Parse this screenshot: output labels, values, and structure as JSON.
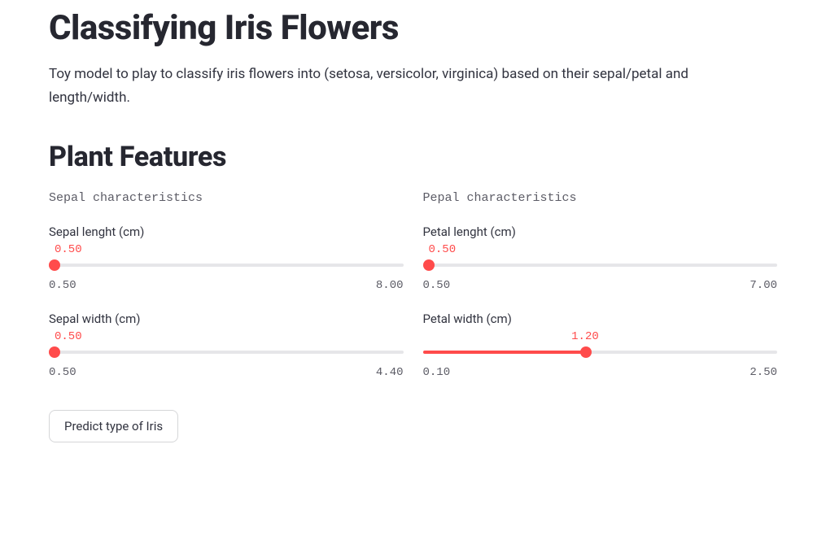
{
  "header": {
    "title": "Classifying Iris Flowers",
    "description": "Toy model to play to classify iris flowers into (setosa, versicolor, virginica) based on their sepal/petal and length/width."
  },
  "section": {
    "title": "Plant Features"
  },
  "left": {
    "group_label": "Sepal characteristics",
    "fields": [
      {
        "label": "Sepal lenght (cm)",
        "value": "0.50",
        "min": "0.50",
        "max": "8.00",
        "percent": 0
      },
      {
        "label": "Sepal width (cm)",
        "value": "0.50",
        "min": "0.50",
        "max": "4.40",
        "percent": 0
      }
    ]
  },
  "right": {
    "group_label": "Pepal characteristics",
    "fields": [
      {
        "label": "Petal lenght (cm)",
        "value": "0.50",
        "min": "0.50",
        "max": "7.00",
        "percent": 0
      },
      {
        "label": "Petal width (cm)",
        "value": "1.20",
        "min": "0.10",
        "max": "2.50",
        "percent": 45.8
      }
    ]
  },
  "button": {
    "label": "Predict type of Iris"
  },
  "colors": {
    "accent": "#ff4b4b"
  }
}
